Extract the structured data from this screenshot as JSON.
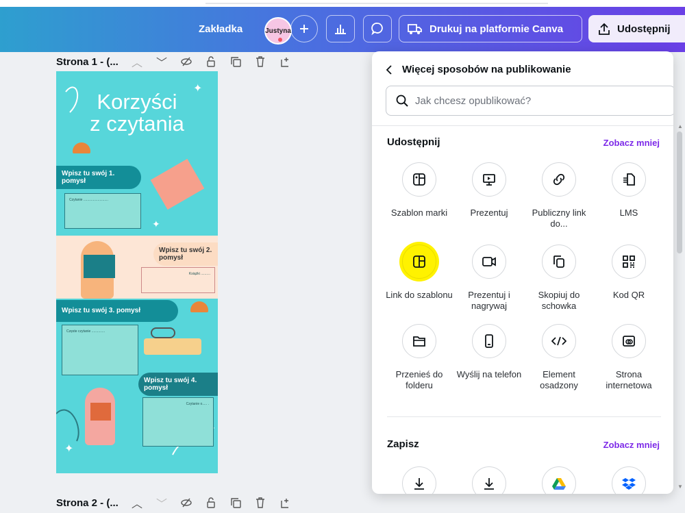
{
  "header": {
    "bookmark_label": "Zakładka",
    "avatar_name": "Justyna",
    "print_label": "Drukuj na platformie Canva",
    "share_label": "Udostępnij",
    "gradient": [
      "#2e9fcf",
      "#6a3fe6"
    ]
  },
  "pages": [
    {
      "title": "Strona 1 - (..."
    },
    {
      "title": "Strona 2 - (..."
    }
  ],
  "design": {
    "title_line1": "Korzyści",
    "title_line2": "z czytania",
    "idea1": "Wpisz tu swój 1. pomysł",
    "idea2": "Wpisz tu swój 2. pomysł",
    "idea3": "Wpisz tu swój 3. pomysł",
    "idea4": "Wpisz tu swój 4. pomysł",
    "note1": "Czytanie ..........................",
    "note2": "Książki ..........",
    "note3": "Częste czytanie ..............",
    "note4": "Czytanie o..... ."
  },
  "panel": {
    "back_title": "Więcej sposobów na publikowanie",
    "search_placeholder": "Jak chcesz opublikować?",
    "share_section": {
      "title": "Udostępnij",
      "toggle": "Zobacz mniej",
      "items": [
        {
          "label": "Szablon marki",
          "icon": "brand-template-icon"
        },
        {
          "label": "Prezentuj",
          "icon": "present-icon"
        },
        {
          "label": "Publiczny link do...",
          "icon": "link-icon"
        },
        {
          "label": "LMS",
          "icon": "lms-icon"
        },
        {
          "label": "Link do szablonu",
          "icon": "template-link-icon"
        },
        {
          "label": "Prezentuj i nagrywaj",
          "icon": "record-icon"
        },
        {
          "label": "Skopiuj do schowka",
          "icon": "copy-icon"
        },
        {
          "label": "Kod QR",
          "icon": "qr-code-icon"
        },
        {
          "label": "Przenieś do folderu",
          "icon": "folder-icon"
        },
        {
          "label": "Wyślij na telefon",
          "icon": "phone-icon"
        },
        {
          "label": "Element osadzony",
          "icon": "embed-icon"
        },
        {
          "label": "Strona internetowa",
          "icon": "website-icon"
        }
      ]
    },
    "save_section": {
      "title": "Zapisz",
      "toggle": "Zobacz mniej",
      "items": [
        {
          "icon": "download-icon"
        },
        {
          "icon": "download-icon"
        },
        {
          "icon": "google-drive-icon"
        },
        {
          "icon": "dropbox-icon"
        }
      ]
    },
    "accent": "#7d2ae8",
    "highlight_color": "#fff200"
  }
}
